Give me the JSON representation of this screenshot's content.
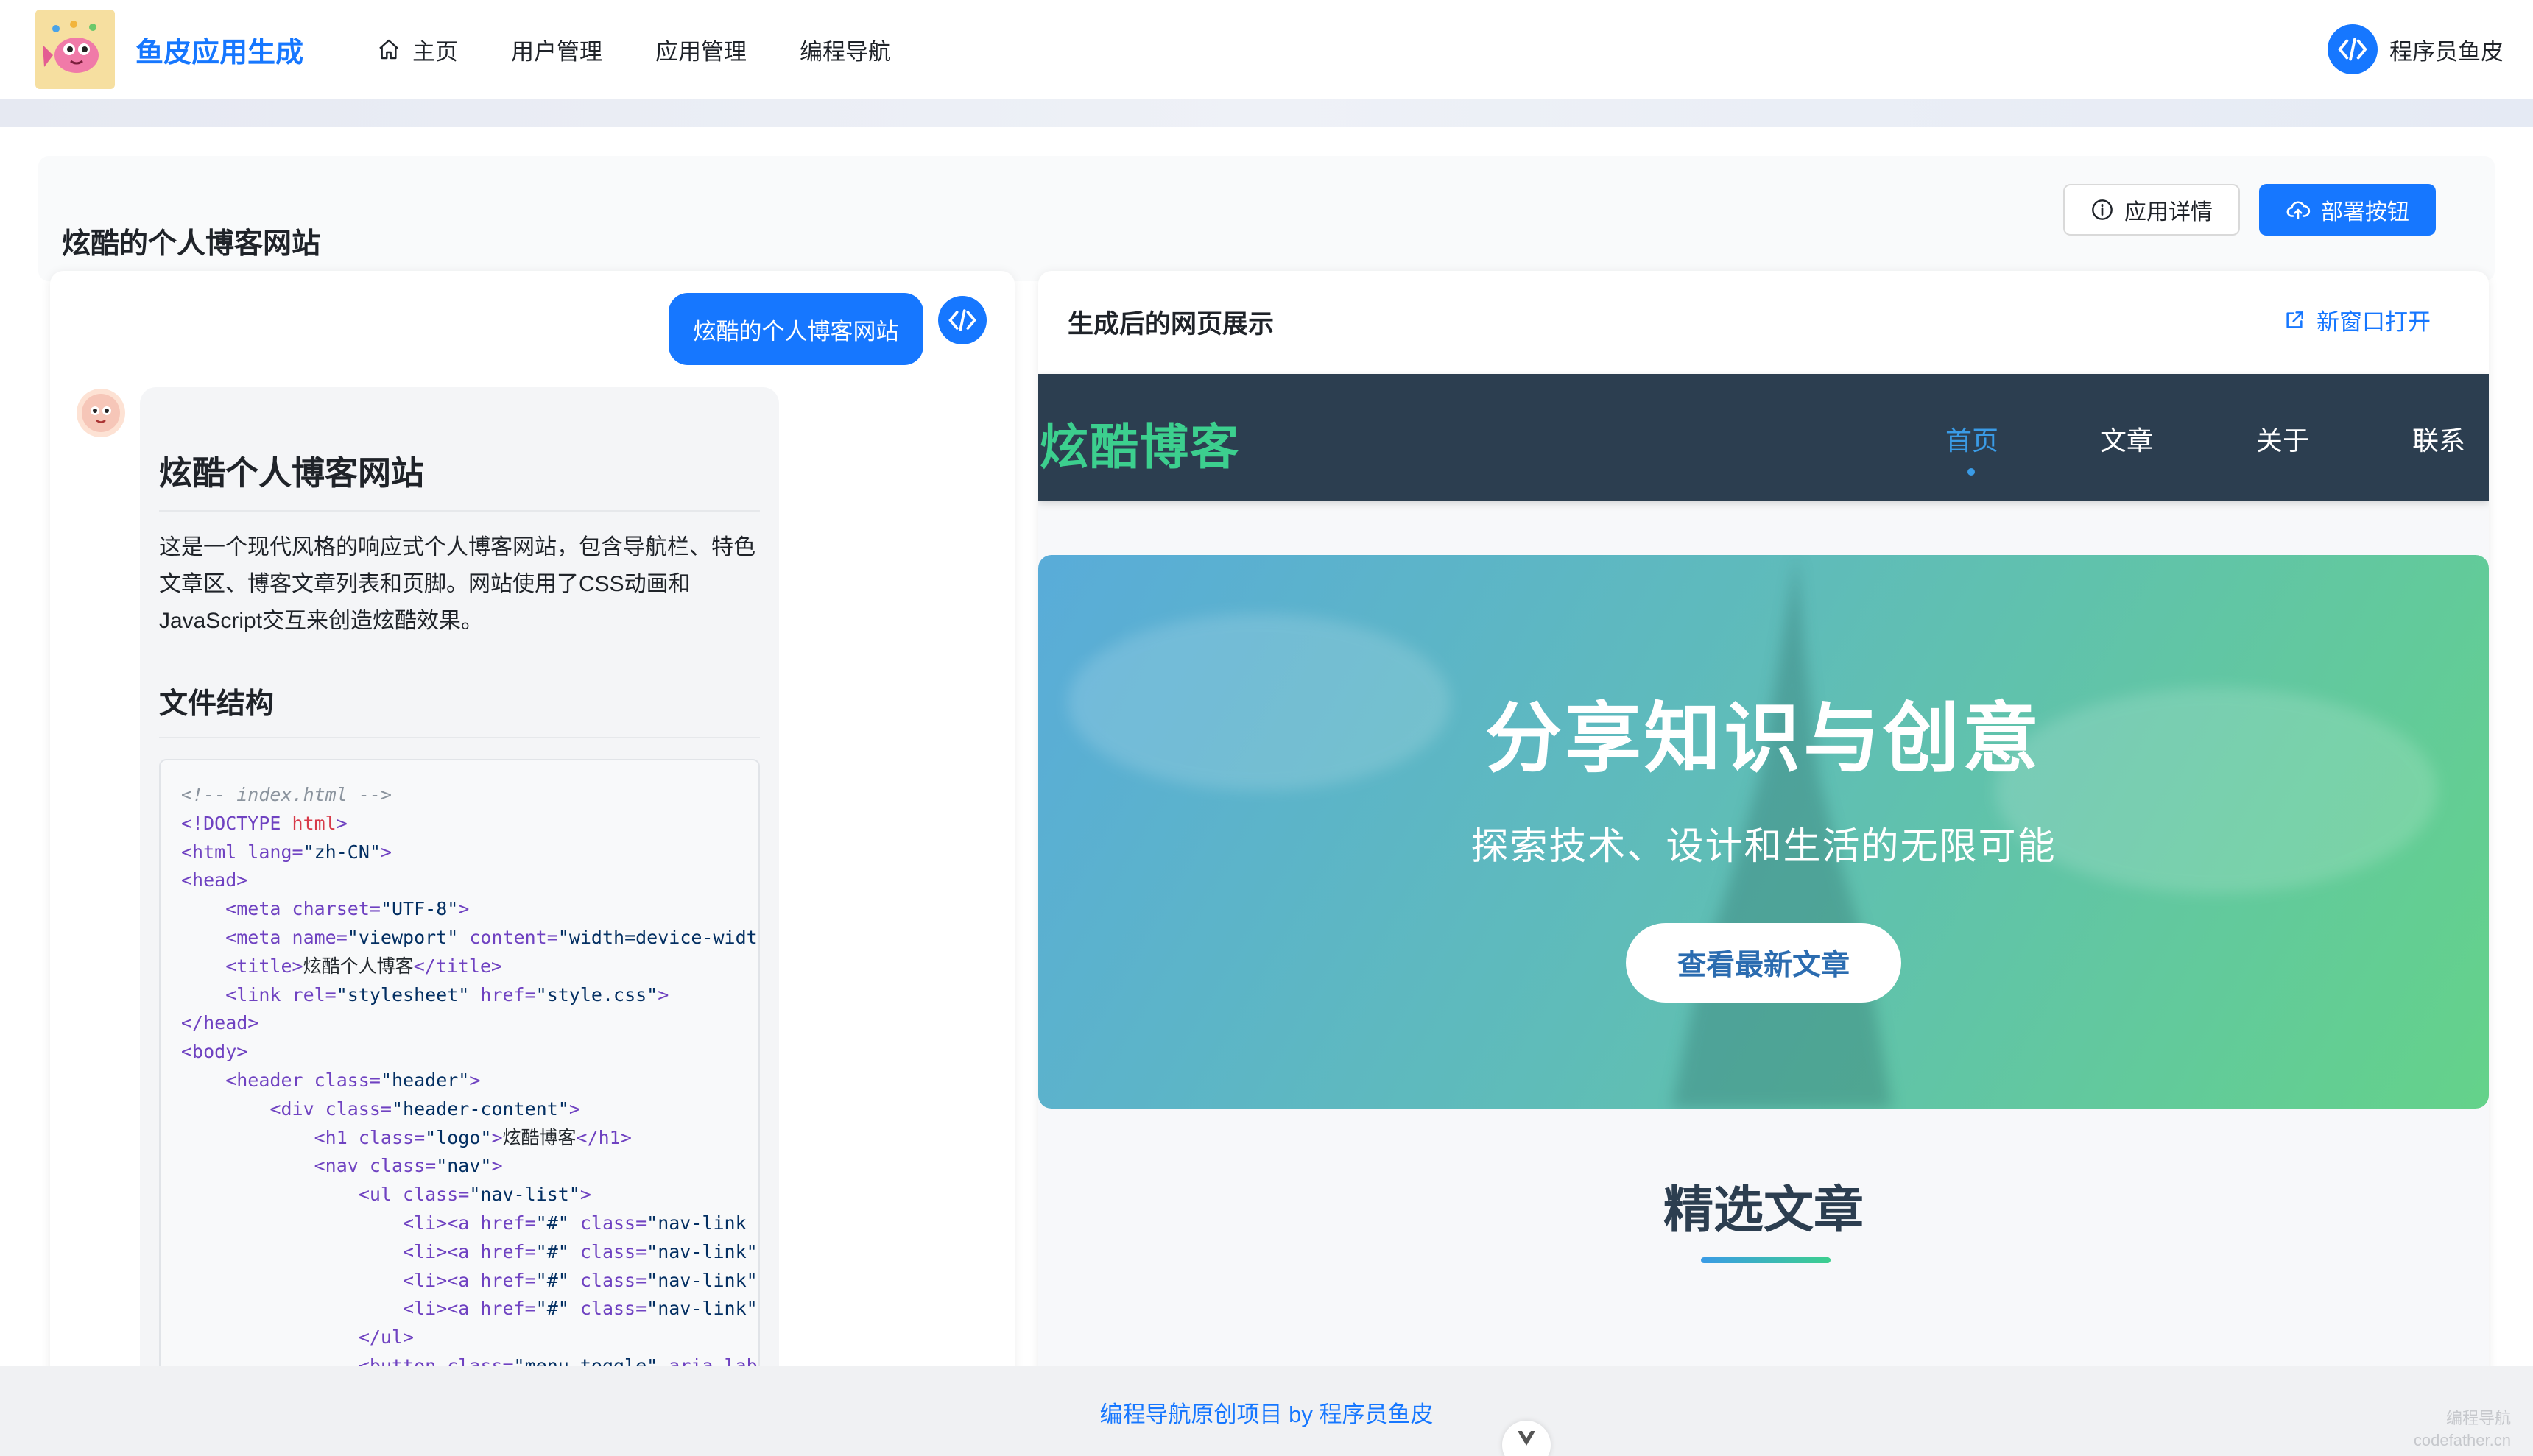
{
  "header": {
    "brand": "鱼皮应用生成",
    "nav": [
      {
        "label": "主页",
        "icon": "home-icon"
      },
      {
        "label": "用户管理"
      },
      {
        "label": "应用管理"
      },
      {
        "label": "编程导航"
      }
    ],
    "user_name": "程序员鱼皮"
  },
  "page": {
    "title": "炫酷的个人博客网站",
    "detail_button": "应用详情",
    "deploy_button": "部署按钮"
  },
  "chat": {
    "user_message": "炫酷的个人博客网站",
    "ai": {
      "heading": "炫酷个人博客网站",
      "paragraph": "这是一个现代风格的响应式个人博客网站，包含导航栏、特色文章区、博客文章列表和页脚。网站使用了CSS动画和JavaScript交互来创造炫酷效果。",
      "section_heading": "文件结构",
      "code_lines": [
        "<!-- index.html -->",
        "<!DOCTYPE html>",
        "<html lang=\"zh-CN\">",
        "<head>",
        "    <meta charset=\"UTF-8\">",
        "    <meta name=\"viewport\" content=\"width=device-width",
        "    <title>炫酷个人博客</title>",
        "    <link rel=\"stylesheet\" href=\"style.css\">",
        "</head>",
        "<body>",
        "    <header class=\"header\">",
        "        <div class=\"header-content\">",
        "            <h1 class=\"logo\">炫酷博客</h1>",
        "            <nav class=\"nav\">",
        "                <ul class=\"nav-list\">",
        "                    <li><a href=\"#\" class=\"nav-link a",
        "                    <li><a href=\"#\" class=\"nav-link\">",
        "                    <li><a href=\"#\" class=\"nav-link\">",
        "                    <li><a href=\"#\" class=\"nav-link\">",
        "                </ul>",
        "                <button class=\"menu-toggle\" aria-labe"
      ]
    }
  },
  "preview": {
    "title": "生成后的网页展示",
    "open_new": "新窗口打开",
    "site": {
      "logo": "炫酷博客",
      "nav": [
        "首页",
        "文章",
        "关于",
        "联系"
      ],
      "active_nav": "首页",
      "hero_title": "分享知识与创意",
      "hero_subtitle": "探索技术、设计和生活的无限可能",
      "hero_button": "查看最新文章",
      "featured_title": "精选文章"
    }
  },
  "footer": {
    "text": "编程导航原创项目 by 程序员鱼皮",
    "watermark_line1": "编程导航",
    "watermark_line2": "codefather.cn"
  },
  "colors": {
    "primary": "#1677ff",
    "site_nav_bg": "#2c3e50",
    "site_logo": "#3ccf8e",
    "site_active": "#3a9be6"
  }
}
